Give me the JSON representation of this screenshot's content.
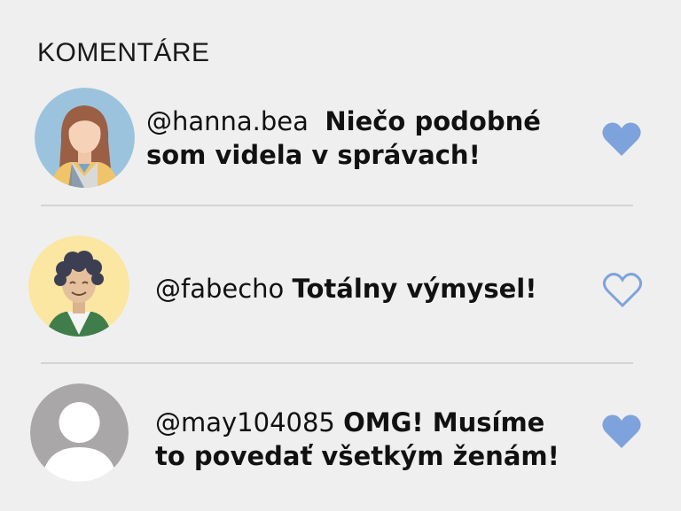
{
  "section": {
    "title": "KOMENTÁRE"
  },
  "comments": [
    {
      "username": "@hanna.bea",
      "message_line1": "Niečo podobné",
      "message_line2": "som videla v správach!",
      "liked": true,
      "avatar_icon": "woman-avatar-icon"
    },
    {
      "username": "@fabecho",
      "message": "Totálny výmysel!",
      "liked": false,
      "avatar_icon": "curly-hair-man-avatar-icon"
    },
    {
      "username": "@may104085",
      "message_line1": "OMG! Musíme",
      "message_line2": "to povedať všetkým ženám!",
      "liked": true,
      "avatar_icon": "default-user-avatar-icon"
    }
  ],
  "colors": {
    "heart": "#7ea3dc",
    "background": "#efefef",
    "divider": "#d3d3d3"
  }
}
